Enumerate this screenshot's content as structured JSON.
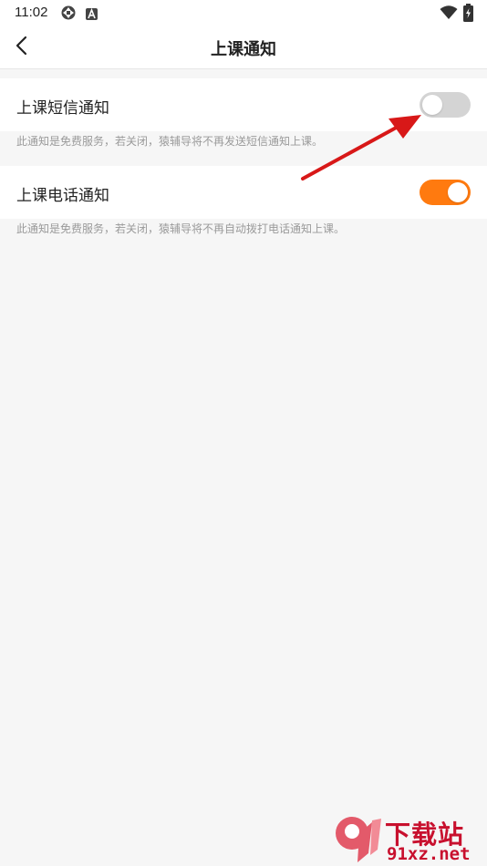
{
  "status_bar": {
    "time": "11:02",
    "icons": [
      "sync-icon",
      "a-letter-icon",
      "wifi-icon",
      "battery-icon"
    ]
  },
  "header": {
    "title": "上课通知",
    "back_icon": "chevron-left-icon"
  },
  "settings": [
    {
      "label": "上课短信通知",
      "description": "此通知是免费服务，若关闭，猿辅导将不再发送短信通知上课。",
      "enabled": false
    },
    {
      "label": "上课电话通知",
      "description": "此通知是免费服务，若关闭，猿辅导将不再自动拨打电话通知上课。",
      "enabled": true
    }
  ],
  "colors": {
    "toggle_on": "#ff7a0f",
    "toggle_off": "#d4d4d4",
    "annotation_arrow": "#d81818",
    "background": "#f6f6f6"
  },
  "watermark": {
    "text": "下载站",
    "url": "91xz.net"
  }
}
